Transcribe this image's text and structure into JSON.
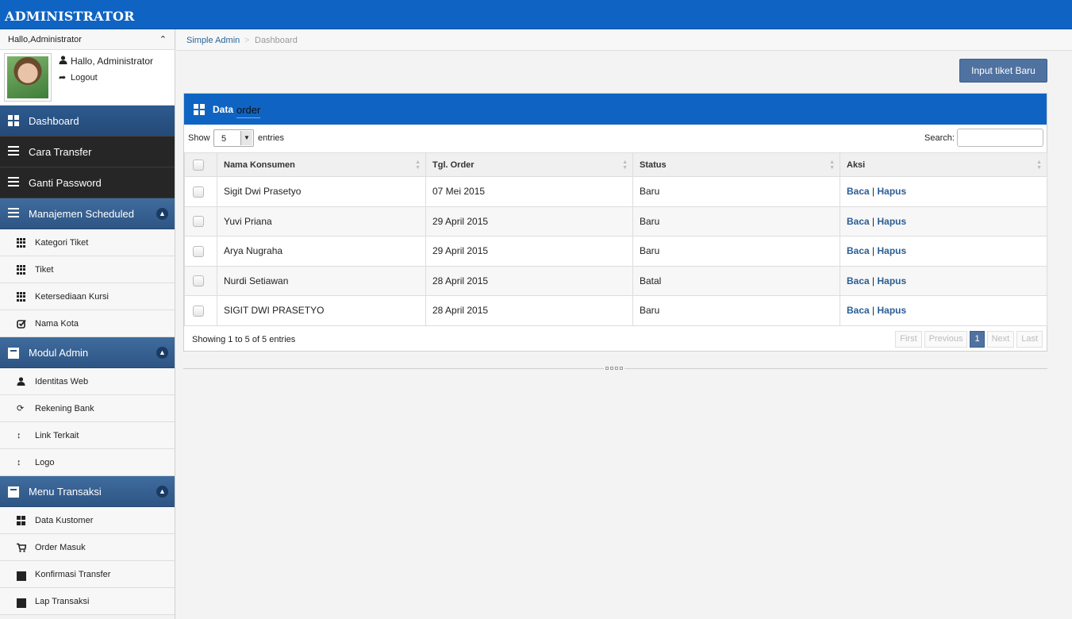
{
  "header": {
    "brand": "ADMINISTRATOR"
  },
  "sidebar": {
    "greeting_head": "Hallo,Administrator",
    "user_name": "Hallo, Administrator",
    "logout": "Logout",
    "items": [
      {
        "label": "Dashboard",
        "type": "main"
      },
      {
        "label": "Cara Transfer",
        "type": "main"
      },
      {
        "label": "Ganti Password",
        "type": "main"
      },
      {
        "label": "Manajemen Scheduled",
        "type": "main"
      },
      {
        "label": "Kategori Tiket",
        "type": "sub",
        "icon": "grid-icon"
      },
      {
        "label": "Tiket",
        "type": "sub",
        "icon": "grid-icon"
      },
      {
        "label": "Ketersediaan Kursi",
        "type": "sub",
        "icon": "grid-icon"
      },
      {
        "label": "Nama Kota",
        "type": "sub",
        "icon": "check-square-icon"
      },
      {
        "label": "Modul Admin",
        "type": "main"
      },
      {
        "label": "Identitas Web",
        "type": "sub",
        "icon": "user-icon"
      },
      {
        "label": "Rekening Bank",
        "type": "sub",
        "icon": "refresh-icon"
      },
      {
        "label": "Link Terkait",
        "type": "sub",
        "icon": "resize-vertical-icon"
      },
      {
        "label": "Logo",
        "type": "sub",
        "icon": "resize-vertical-icon"
      },
      {
        "label": "Menu Transaksi",
        "type": "main"
      },
      {
        "label": "Data Kustomer",
        "type": "sub",
        "icon": "th-large-icon"
      },
      {
        "label": "Order Masuk",
        "type": "sub",
        "icon": "cart-icon"
      },
      {
        "label": "Konfirmasi Transfer",
        "type": "sub",
        "icon": "folder-icon"
      },
      {
        "label": "Lap Transaksi",
        "type": "sub",
        "icon": "folder-icon"
      }
    ]
  },
  "breadcrumb": {
    "home": "Simple Admin",
    "separator": ">",
    "current": "Dashboard"
  },
  "actions": {
    "new_ticket": "Input tiket Baru"
  },
  "panel": {
    "title_bold": "Data",
    "title_rest": "order",
    "show_label": "Show",
    "page_size": "5",
    "entries_label": "entries",
    "search_label": "Search:",
    "columns": [
      "Nama Konsumen",
      "Tgl. Order",
      "Status",
      "Aksi"
    ],
    "rows": [
      {
        "name": "Sigit Dwi Prasetyo",
        "date": "07 Mei 2015",
        "status": "Baru"
      },
      {
        "name": "Yuvi Priana",
        "date": "29 April 2015",
        "status": "Baru"
      },
      {
        "name": "Arya Nugraha",
        "date": "29 April 2015",
        "status": "Baru"
      },
      {
        "name": "Nurdi Setiawan",
        "date": "28 April 2015",
        "status": "Batal"
      },
      {
        "name": "SIGIT DWI PRASETYO",
        "date": "28 April 2015",
        "status": "Baru"
      }
    ],
    "action_read": "Baca",
    "action_sep": "|",
    "action_delete": "Hapus",
    "info": "Showing 1 to 5 of 5 entries",
    "pager": {
      "first": "First",
      "previous": "Previous",
      "page": "1",
      "next": "Next",
      "last": "Last"
    }
  },
  "colors": {
    "topbar": "#0f64c3",
    "nav_blue": "#2e5584",
    "nav_dark": "#262626",
    "link": "#2a5d95"
  }
}
